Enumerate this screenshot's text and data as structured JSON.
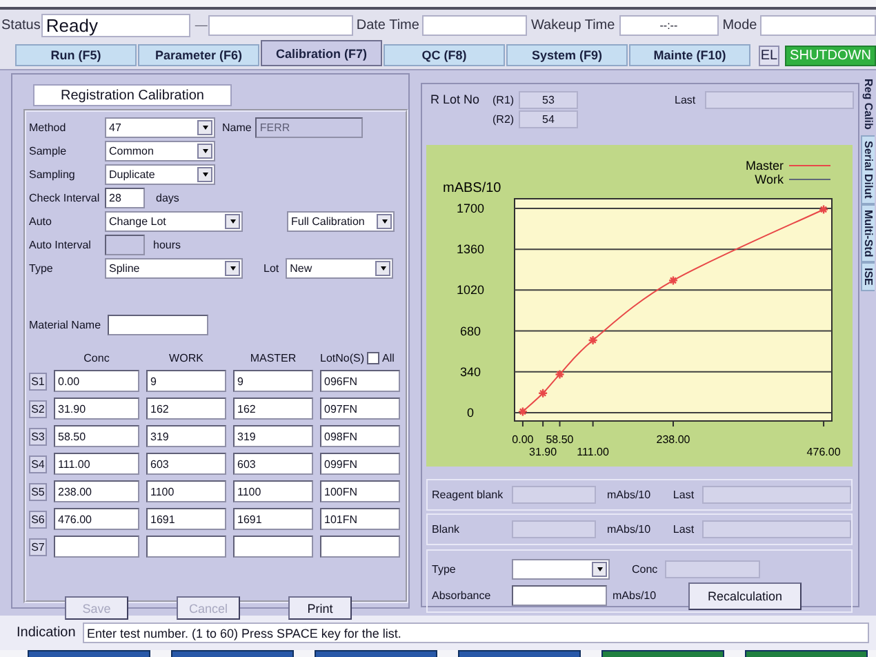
{
  "header": {
    "status_label": "Status",
    "status": "Ready",
    "separator": "—",
    "date_time_label": "Date Time",
    "wakeup_time_label": "Wakeup Time",
    "wakeup_time": "--:--",
    "mode_label": "Mode"
  },
  "tabs": [
    {
      "label": "Run (F5)",
      "selected": false
    },
    {
      "label": "Parameter (F6)",
      "selected": false
    },
    {
      "label": "Calibration (F7)",
      "selected": true
    },
    {
      "label": "QC (F8)",
      "selected": false
    },
    {
      "label": "System (F9)",
      "selected": false
    },
    {
      "label": "Mainte (F10)",
      "selected": false
    }
  ],
  "el_button": "EL",
  "shutdown_button": "SHUTDOWN",
  "side_tabs": [
    {
      "label": "Reg Calib",
      "selected": true
    },
    {
      "label": "Serial Dilut",
      "selected": false
    },
    {
      "label": "Multi-Std",
      "selected": false
    },
    {
      "label": "ISE",
      "selected": false
    }
  ],
  "registration": {
    "title": "Registration Calibration",
    "rows": [
      {
        "label": "Method",
        "controls": [
          {
            "kind": "select",
            "value": "47"
          },
          {
            "kind": "text",
            "text": "Name"
          },
          {
            "kind": "input",
            "value": "FERR",
            "disabled": true
          }
        ]
      },
      {
        "label": "Sample",
        "controls": [
          {
            "kind": "select",
            "value": "Common"
          }
        ]
      },
      {
        "label": "Sampling",
        "controls": [
          {
            "kind": "select",
            "value": "Duplicate"
          }
        ]
      },
      {
        "label": "Check Interval",
        "controls": [
          {
            "kind": "input",
            "value": "28",
            "disabled": false
          },
          {
            "kind": "text",
            "text": "days"
          }
        ]
      },
      {
        "label": "Auto",
        "controls": [
          {
            "kind": "select",
            "value": "Change Lot"
          },
          {
            "kind": "select",
            "value": "Full Calibration"
          }
        ]
      },
      {
        "label": "Auto Interval",
        "controls": [
          {
            "kind": "input",
            "disabled": true
          },
          {
            "kind": "text",
            "text": "hours"
          }
        ]
      },
      {
        "label": "Type",
        "controls": [
          {
            "kind": "select",
            "value": "Spline"
          },
          {
            "kind": "text",
            "text": "Lot"
          },
          {
            "kind": "select",
            "value": "New"
          }
        ]
      }
    ],
    "material_name_label": "Material Name",
    "table": {
      "columns": [
        "Conc",
        "WORK",
        "MASTER",
        "LotNo(S)"
      ],
      "all_label": "All",
      "all_checked": false,
      "rows": [
        {
          "label": "S1",
          "cells": [
            "0.00",
            "9",
            "9",
            "096FN"
          ]
        },
        {
          "label": "S2",
          "cells": [
            "31.90",
            "162",
            "162",
            "097FN"
          ]
        },
        {
          "label": "S3",
          "cells": [
            "58.50",
            "319",
            "319",
            "098FN"
          ]
        },
        {
          "label": "S4",
          "cells": [
            "111.00",
            "603",
            "603",
            "099FN"
          ]
        },
        {
          "label": "S5",
          "cells": [
            "238.00",
            "1100",
            "1100",
            "100FN"
          ]
        },
        {
          "label": "S6",
          "cells": [
            "476.00",
            "1691",
            "1691",
            "101FN"
          ]
        },
        {
          "label": "S7"
        }
      ]
    },
    "buttons": [
      {
        "label": "Save",
        "disabled": true
      },
      {
        "label": "Cancel",
        "disabled": true
      },
      {
        "label": "Print",
        "disabled": false
      }
    ]
  },
  "result": {
    "r_lot_label": "R Lot No",
    "r_lots": [
      {
        "label": "(R1)",
        "value": "53"
      },
      {
        "label": "(R2)",
        "value": "54"
      }
    ],
    "last_label": "Last",
    "chart_data": {
      "type": "line",
      "ylabel": "mABS/10",
      "x": [
        0,
        31.9,
        58.5,
        111,
        238,
        476
      ],
      "grid": true,
      "legend": "top-right",
      "series": [
        {
          "name": "Master",
          "color": "#e84848",
          "marker": "cross",
          "values": [
            9,
            162,
            319,
            603,
            1100,
            1691
          ]
        },
        {
          "name": "Work",
          "color": "#606878",
          "values": [
            null,
            null,
            null,
            null,
            null,
            null
          ]
        }
      ],
      "xlim": [
        -13,
        489
      ],
      "ylim": [
        -69,
        1780
      ],
      "xticks": [
        {
          "value": 0,
          "label": "0.00"
        },
        {
          "value": 58.5,
          "label": "58.50"
        },
        {
          "value": 238,
          "label": "238.00"
        }
      ],
      "yticks": [
        0,
        340,
        680,
        1020,
        1360,
        1700
      ]
    },
    "lower_x_labels": [
      "31.90",
      "111.00",
      "476.00"
    ],
    "blanks": [
      {
        "label": "Reagent blank",
        "unit": "mAbs/10",
        "last_label": "Last"
      },
      {
        "label": "Blank",
        "unit": "mAbs/10",
        "last_label": "Last"
      }
    ],
    "recalc": {
      "type_label": "Type",
      "conc_label": "Conc",
      "absorbance_label": "Absorbance",
      "unit": "mAbs/10",
      "button": "Recalculation"
    }
  },
  "indication": {
    "label": "Indication",
    "message": "Enter test number. (1 to 60) Press SPACE key for the list."
  },
  "function_buttons": [
    {
      "color": "#2858a8"
    },
    {
      "color": "#2858a8"
    },
    {
      "color": "#2858a8"
    },
    {
      "color": "#2858a8"
    },
    {
      "color": "#208040"
    },
    {
      "color": "#208040"
    }
  ]
}
